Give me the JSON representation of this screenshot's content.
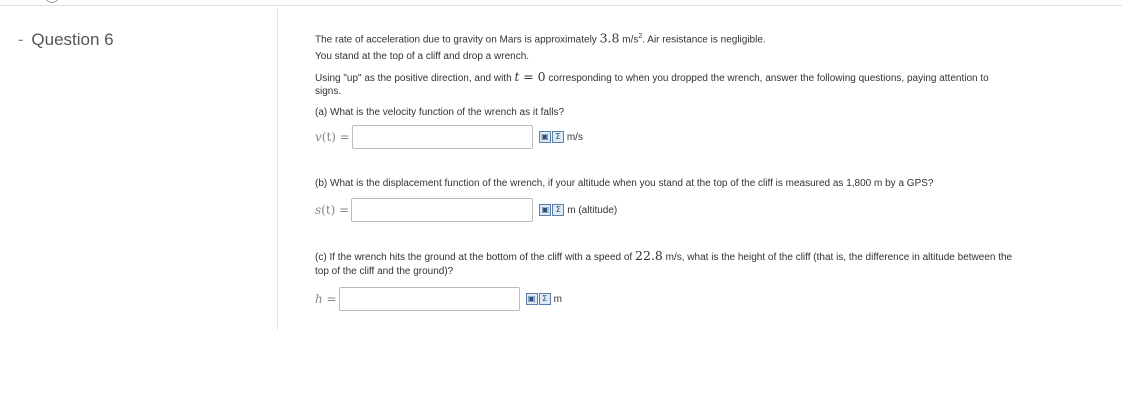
{
  "question": {
    "dash": "-",
    "label": "Question 6"
  },
  "problem": {
    "line1_pre": "The rate of acceleration due to gravity on Mars is approximately ",
    "line1_math": "3.8",
    "line1_unit": " m/s",
    "line1_sup": "2",
    "line1_post": ".  Air resistance is negligible.",
    "line2": "You stand at the top of a cliff and drop a wrench.",
    "line3_pre": "Using \"up\" as the positive direction, and with ",
    "line3_math_t": "t",
    "line3_math_eq": " = 0",
    "line3_post": " corresponding to when you dropped the wrench, answer the following questions, paying attention to",
    "line4": "signs."
  },
  "parts": {
    "a": {
      "question": "(a) What is the velocity function of the wrench as it falls?",
      "lhs_var": "v",
      "lhs_arg": "(t)",
      "lhs_eq": " =",
      "value": "",
      "unit": "m/s"
    },
    "b": {
      "question": "(b) What is the displacement function of the wrench, if your altitude when you stand at the top of the cliff is measured as 1,800 m by a GPS?",
      "lhs_var": "s",
      "lhs_arg": "(t)",
      "lhs_eq": " =",
      "value": "",
      "unit": "m (altitude)"
    },
    "c": {
      "question_pre": "(c) If the wrench hits the ground at the bottom of the cliff with a speed of ",
      "question_math": "22.8",
      "question_post": " m/s, what is the height of the cliff (that is, the difference in altitude between the",
      "question_line2": "top of the cliff and the ground)?",
      "lhs_var": "h",
      "lhs_eq": " =",
      "value": "",
      "unit": "m"
    }
  },
  "icons": {
    "preview": "preview-icon",
    "equation_editor": "sigma-icon",
    "preview_glyph": "▣",
    "sigma_glyph": "Σ"
  }
}
